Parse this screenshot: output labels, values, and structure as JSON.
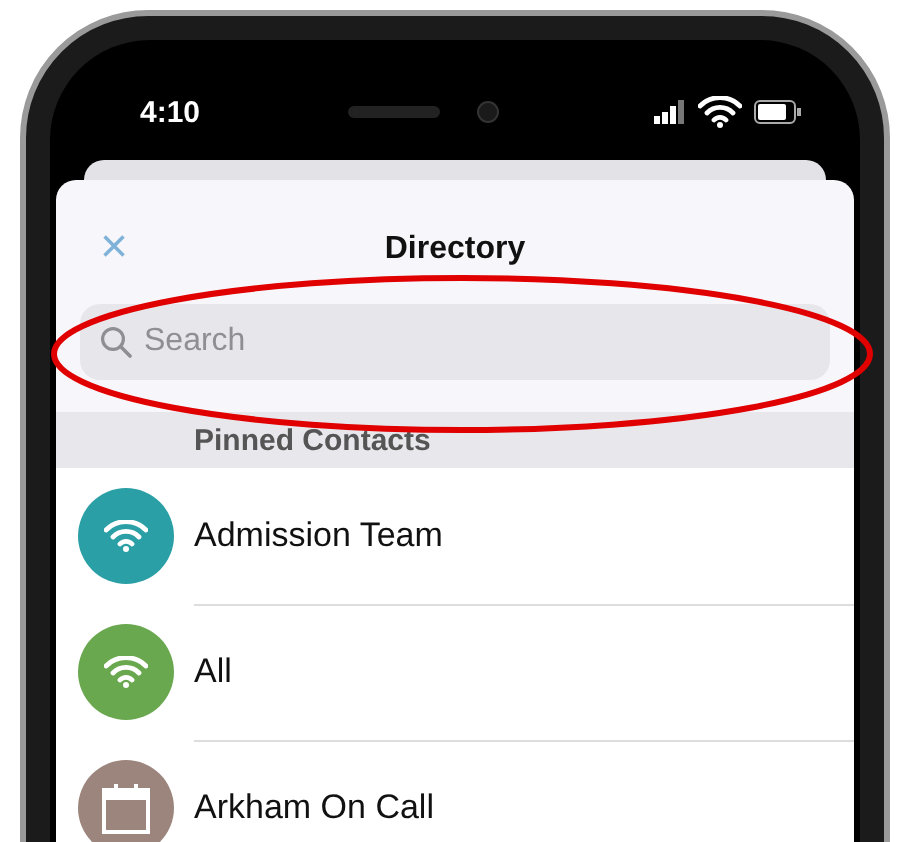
{
  "status_bar": {
    "time": "4:10"
  },
  "sheet": {
    "title": "Directory",
    "close_glyph": "×"
  },
  "search": {
    "placeholder": "Search"
  },
  "section": {
    "title": "Pinned Contacts"
  },
  "contacts": [
    {
      "name": "Admission Team",
      "kind": "group",
      "color": "#2a9fa6"
    },
    {
      "name": "All",
      "kind": "group",
      "color": "#6aa84f"
    },
    {
      "name": "Arkham On Call",
      "kind": "schedule",
      "color": "#9b857c"
    }
  ]
}
